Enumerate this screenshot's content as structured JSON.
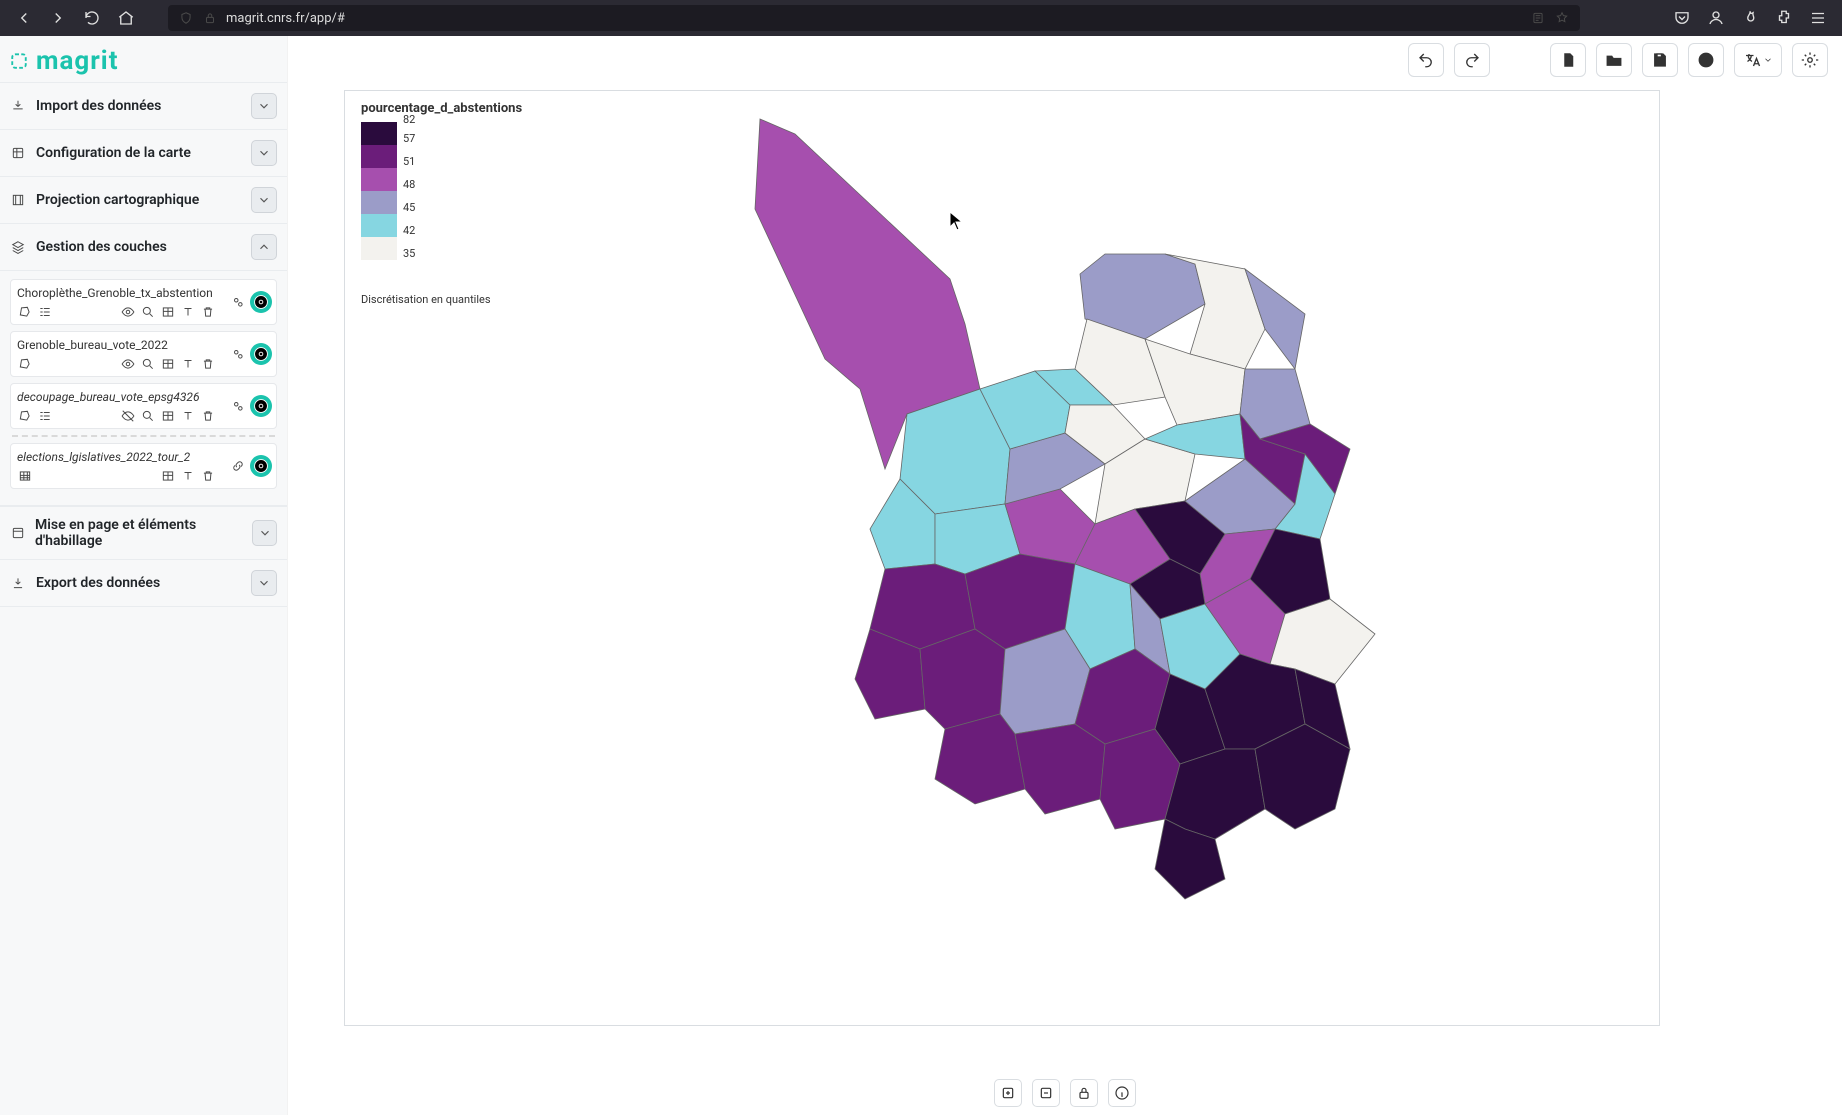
{
  "browser": {
    "url": "magrit.cnrs.fr/app/#"
  },
  "app": {
    "logo_text": "magrit"
  },
  "panels": {
    "import": "Import des données",
    "config": "Configuration de la carte",
    "proj": "Projection cartographique",
    "layers": "Gestion des couches",
    "layout": "Mise en page et éléments d'habillage",
    "export": "Export des données"
  },
  "layers": [
    {
      "name": "Choroplèthe_Grenoble_tx_abstention",
      "italic": false,
      "legend": true,
      "table": false,
      "visible": true
    },
    {
      "name": "Grenoble_bureau_vote_2022",
      "italic": false,
      "legend": false,
      "table": false,
      "visible": true
    },
    {
      "name": "decoupage_bureau_vote_epsg4326",
      "italic": true,
      "legend": true,
      "table": false,
      "visible": false
    },
    {
      "name": "elections_lgislatives_2022_tour_2",
      "italic": true,
      "legend": false,
      "table": true,
      "visible": true
    }
  ],
  "map": {
    "legend_title": "pourcentage_d_abstentions",
    "legend_note": "Discrétisation en quantiles",
    "ticks": [
      "82",
      "57",
      "51",
      "48",
      "45",
      "42",
      "35"
    ],
    "colors": [
      "#2a0b3d",
      "#6b1d7a",
      "#a64fae",
      "#9b9cc8",
      "#86d6e1",
      "#f3f2ee"
    ]
  }
}
